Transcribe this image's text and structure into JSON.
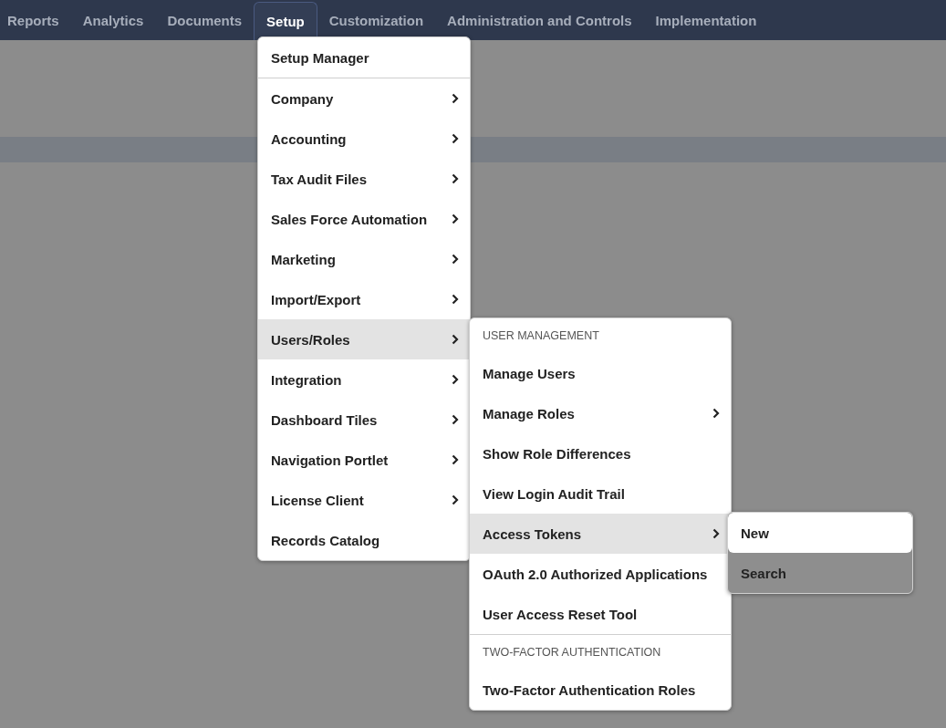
{
  "nav": {
    "tabs": [
      {
        "label": "Reports",
        "selected": false
      },
      {
        "label": "Analytics",
        "selected": false
      },
      {
        "label": "Documents",
        "selected": false
      },
      {
        "label": "Setup",
        "selected": true
      },
      {
        "label": "Customization",
        "selected": false
      },
      {
        "label": "Administration and Controls",
        "selected": false
      },
      {
        "label": "Implementation",
        "selected": false
      }
    ]
  },
  "menus": [
    {
      "items": [
        {
          "kind": "item",
          "label": "Setup Manager",
          "has_submenu": false,
          "selected": false,
          "separated": false
        },
        {
          "kind": "item",
          "label": "Company",
          "has_submenu": true,
          "selected": false,
          "separated": true
        },
        {
          "kind": "item",
          "label": "Accounting",
          "has_submenu": true,
          "selected": false,
          "separated": false
        },
        {
          "kind": "item",
          "label": "Tax Audit Files",
          "has_submenu": true,
          "selected": false,
          "separated": false
        },
        {
          "kind": "item",
          "label": "Sales Force Automation",
          "has_submenu": true,
          "selected": false,
          "separated": false
        },
        {
          "kind": "item",
          "label": "Marketing",
          "has_submenu": true,
          "selected": false,
          "separated": false
        },
        {
          "kind": "item",
          "label": "Import/Export",
          "has_submenu": true,
          "selected": false,
          "separated": false
        },
        {
          "kind": "item",
          "label": "Users/Roles",
          "has_submenu": true,
          "selected": true,
          "separated": false
        },
        {
          "kind": "item",
          "label": "Integration",
          "has_submenu": true,
          "selected": false,
          "separated": false
        },
        {
          "kind": "item",
          "label": "Dashboard Tiles",
          "has_submenu": true,
          "selected": false,
          "separated": false
        },
        {
          "kind": "item",
          "label": "Navigation Portlet",
          "has_submenu": true,
          "selected": false,
          "separated": false
        },
        {
          "kind": "item",
          "label": "License Client",
          "has_submenu": true,
          "selected": false,
          "separated": false
        },
        {
          "kind": "item",
          "label": "Records Catalog",
          "has_submenu": false,
          "selected": false,
          "separated": false
        }
      ]
    },
    {
      "items": [
        {
          "kind": "header",
          "label": "USER MANAGEMENT",
          "separated": false
        },
        {
          "kind": "item",
          "label": "Manage Users",
          "has_submenu": false,
          "selected": false,
          "separated": false
        },
        {
          "kind": "item",
          "label": "Manage Roles",
          "has_submenu": true,
          "selected": false,
          "separated": false
        },
        {
          "kind": "item",
          "label": "Show Role Differences",
          "has_submenu": false,
          "selected": false,
          "separated": false
        },
        {
          "kind": "item",
          "label": "View Login Audit Trail",
          "has_submenu": false,
          "selected": false,
          "separated": false
        },
        {
          "kind": "item",
          "label": "Access Tokens",
          "has_submenu": true,
          "selected": true,
          "separated": false
        },
        {
          "kind": "item",
          "label": "OAuth 2.0 Authorized Applications",
          "has_submenu": false,
          "selected": false,
          "separated": false
        },
        {
          "kind": "item",
          "label": "User Access Reset Tool",
          "has_submenu": false,
          "selected": false,
          "separated": false
        },
        {
          "kind": "header",
          "label": "TWO-FACTOR AUTHENTICATION",
          "separated": true
        },
        {
          "kind": "item",
          "label": "Two-Factor Authentication Roles",
          "has_submenu": false,
          "selected": false,
          "separated": false
        }
      ]
    },
    {
      "items": [
        {
          "kind": "item",
          "label": "New",
          "has_submenu": false,
          "selected": true,
          "separated": false
        },
        {
          "kind": "item",
          "label": "Search",
          "has_submenu": false,
          "selected": false,
          "separated": false
        }
      ]
    }
  ]
}
